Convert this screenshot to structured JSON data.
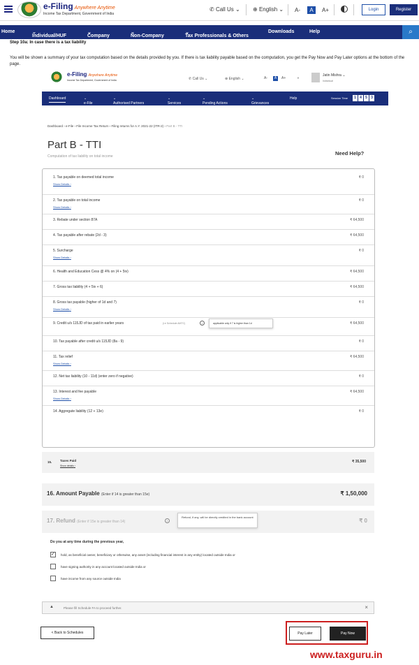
{
  "header": {
    "logo_title": "e-Filing",
    "logo_tagline": "Anywhere Anytime",
    "logo_sub": "Income Tax Department, Government of India",
    "call_us": "Call Us",
    "language": "English",
    "font_small": "A-",
    "font_normal": "A",
    "font_large": "A+",
    "login": "Login",
    "register": "Register"
  },
  "nav": [
    "Home",
    "Individual/HUF",
    "Company",
    "Non-Company",
    "Tax Professionals & Others",
    "Downloads",
    "Help"
  ],
  "step": {
    "title": "Step 10a: In case there is a tax liability",
    "description": "You will be shown a summary of your tax computation based on the details provided by you. If there is tax liability payable based on the computation, you get the Pay Now and Pay Later options at the bottom of the page."
  },
  "inner": {
    "logo_title": "e-Filing",
    "logo_tagline": "Anywhere Anytime",
    "logo_sub": "Income Tax Department, Government of India",
    "call_us": "Call Us",
    "language": "English",
    "user_name": "Jatin Mishra",
    "user_type": "Individual",
    "nav": [
      "Dashboard",
      "e-File",
      "Authorised Partners",
      "Services",
      "Pending Actions",
      "Grievances",
      "Help"
    ],
    "session_label": "Session Time",
    "session_digits": [
      "1",
      "4",
      "5",
      "3"
    ],
    "breadcrumb": "Dashboard › e-File › File Income Tax Return › Filing returns for A.Y. 2021-22 (ITR-2) ›",
    "breadcrumb_current": "Part B - TTI",
    "page_title": "Part B - TTI",
    "page_subtitle": "Computation of tax liability on total income",
    "need_help": "Need Help?",
    "show_details": "Show Details",
    "rows": [
      {
        "label": "1. Tax payable on deemed total income",
        "amount": "₹ 0",
        "details": true
      },
      {
        "label": "2. Tax payable on total income",
        "amount": "₹ 0",
        "details": true
      },
      {
        "label": "3. Rebate under section 87A",
        "amount": "₹ 64,500",
        "details": false
      },
      {
        "label": "4. Tax payable after rebate  (2d - 3)",
        "amount": "₹ 64,500",
        "details": false
      },
      {
        "label": "5. Surcharge",
        "amount": "₹ 0",
        "details": true
      },
      {
        "label": "6. Health and Education Cess @ 4% on  (4 + 5iv)",
        "amount": "₹ 64,500",
        "details": false
      },
      {
        "label": "7. Gross tax liability  (4 + 5iv + 6)",
        "amount": "₹ 64,500",
        "details": false
      },
      {
        "label": "8. Gross tax payable (higher of 1d and 7)",
        "amount": "₹ 0",
        "details": true
      },
      {
        "label": "9. Credit u/s 115JD of tax paid  in earlier years",
        "amount": "₹ 64,500",
        "details": false
      },
      {
        "label": "10. Tax payable after credit u/s 115JD (8a - 9)",
        "amount": "₹ 0",
        "details": false
      },
      {
        "label": "11. Tax relief",
        "amount": "₹ 64,500",
        "details": true
      },
      {
        "label": "12. Net tax liability (10 - 11d) (enter zero if negative)",
        "amount": "₹ 0",
        "details": false
      },
      {
        "label": "13. Interest and fee payable",
        "amount": "₹ 64,500",
        "details": true
      },
      {
        "label": "14. Aggregate liability  (12 + 13e)",
        "amount": "₹ 0",
        "details": false
      }
    ],
    "row9_note": "(i.e Schedule AMTC)",
    "row9_tooltip": "applicable only if 7 is higher than 1d",
    "taxes_paid": {
      "num": "15.",
      "label": "Taxes Paid",
      "details": "Show details",
      "amount": "₹ 35,500"
    },
    "amount_payable": {
      "label": "16. Amount Payable",
      "sub": "(Enter if 14 is greater than 15e)",
      "amount": "₹ 1,50,000"
    },
    "refund": {
      "label": "17. Refund",
      "sub": "(Enter if 15e is greater than 14)",
      "amount": "₹ 0",
      "tooltip": "Refund, if any, will be directly credited in the bank account"
    },
    "question": "Do you at any time during the previous year,",
    "options": [
      {
        "label": "hold, as beneficial owner, beneficiary or otherwise, any asset (including financial interest in any entity) located outside India or",
        "checked": true
      },
      {
        "label": "have signing authority in any account located outside India or",
        "checked": false
      },
      {
        "label": "have income from any source outside India",
        "checked": false
      }
    ],
    "warning": "Please fill Schedule FA to proceed further."
  },
  "footer": {
    "back": "< Back to Schedules",
    "pay_later": "Pay Later",
    "pay_now": "Pay Now",
    "watermark": "www.taxguru.in"
  },
  "colors": {
    "brand_navy": "#1a2e7a",
    "highlight_red": "#cc1f1f"
  }
}
